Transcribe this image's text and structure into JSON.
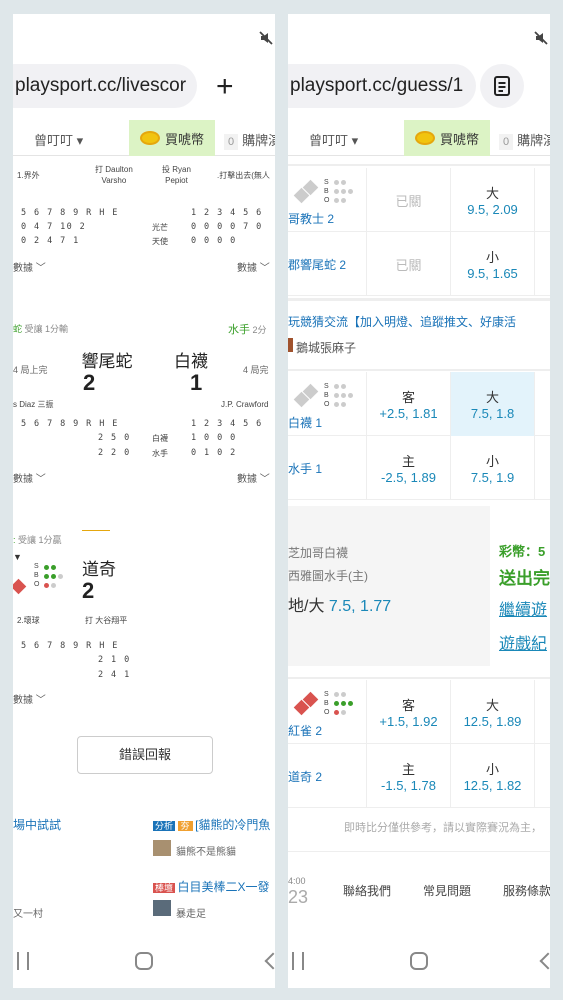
{
  "left": {
    "url": "playsport.cc/livescor",
    "plus": "+",
    "nav": {
      "dropdown": "曾叮叮 ▾",
      "coin": "買唬幣",
      "count": "0",
      "other": "購牌演"
    },
    "game1": {
      "row_label1": "1.界外",
      "batter": "打 Daulton\nVarsho",
      "pitcher": "投 Ryan\nPepiot",
      "right_label": ".打擊出去(無人",
      "innings_hdr": "5 6 7 8 9 R H E",
      "line_a": "0 4        7 10 2",
      "line_b": "0 2        4 7 1",
      "team_a": "光芒",
      "team_b": "天使",
      "inn_hdr_r": "1 2 3 4 5 6",
      "line_c": "0 0 0 0 7 0",
      "line_d": "0 0 0 0",
      "stat_l": "數據 ﹀",
      "stat_r": "數據 ﹀"
    },
    "game2": {
      "status_l": "受讓 1分輸",
      "status_r_team": "水手",
      "status_r": "2分",
      "inning_l": "4 局上完",
      "inning_r": "4 局完",
      "team_home": "響尾蛇",
      "score_home": "2",
      "team_away": "白襪",
      "score_away": "1",
      "pitcher_l": "s Diaz 三振",
      "pitcher_r": "J.P. Crawford",
      "innings_hdr": "5 6 7 8 9 R H E",
      "line_a": "2 5 0",
      "line_b": "2 2 0",
      "team_c": "白襪",
      "team_d": "水手",
      "inn_hdr_r": "1 2 3 4 5 6",
      "line_c": "1 0 0 0",
      "line_d": "0 1 0 2",
      "stat_l": "數據 ﹀",
      "stat_r": "數據 ﹀"
    },
    "game3": {
      "status": "受讓 1分贏",
      "team": "道奇",
      "score": "2",
      "batter_l": "2.壞球",
      "batter_r": "打 大谷翔平",
      "innings_hdr": "5 6 7 8 9 R H E",
      "line_a": "2 1 0",
      "line_b": "2 4 1",
      "stat": "數據 ﹀",
      "sbo": "S\nB\nO"
    },
    "error_btn": "錯誤回報",
    "news": {
      "item1_l": "場中試試",
      "tag1a": "分析",
      "tag1b": "夯",
      "item1_r": "[貓熊的冷門魚",
      "author1": "貓熊不是熊貓",
      "tag2": "棒壇",
      "item2_r": "白目美棒二X一發",
      "item2_l": "又一村",
      "author2": "暴走足"
    }
  },
  "right": {
    "url": "playsport.cc/guess/1",
    "nav": {
      "dropdown": "曾叮叮 ▾",
      "coin": "買唬幣",
      "count": "0",
      "other": "購牌演"
    },
    "closed": "已關",
    "match1": {
      "team_a": "哥教士 2",
      "team_b": "郡響尾蛇 2",
      "a_k": "大",
      "a_v": "9.5, 2.09",
      "b_k": "小",
      "b_v": "9.5, 1.65",
      "sbo": "S\nB\nO"
    },
    "forum": {
      "title": "玩競猜交流【加入明燈、追蹤推文、好康活",
      "author": "鵝城張麻子"
    },
    "match2": {
      "team_a": "白襪 1",
      "team_b": "水手 1",
      "a1_k": "客",
      "a1_v": "+2.5, 1.81",
      "a2_k": "大",
      "a2_v": "7.5, 1.8",
      "b1_k": "主",
      "b1_v": "-2.5, 1.89",
      "b2_k": "小",
      "b2_v": "7.5, 1.9",
      "sbo": "S\nB\nO"
    },
    "promo": {
      "line1": "芝加哥白襪",
      "line2": "西雅圖水手(主)",
      "line3_a": "地/大 ",
      "line3_b": "7.5, 1.77",
      "r1": "彩幣：5",
      "r2": "送出完",
      "r3": "繼續遊",
      "r4": "遊戲紀"
    },
    "match3": {
      "team_a": "紅雀 2",
      "team_b": "道奇 2",
      "a1_k": "客",
      "a1_v": "+1.5, 1.92",
      "a2_k": "大",
      "a2_v": "12.5, 1.89",
      "b1_k": "主",
      "b1_v": "-1.5, 1.78",
      "b2_k": "小",
      "b2_v": "12.5, 1.82",
      "sbo": "S\nB\nO"
    },
    "disclaimer": "即時比分僅供參考，請以實際賽況為主，",
    "footer": {
      "time_small": "4:00",
      "time_big": "23",
      "contact": "聯絡我們",
      "faq": "常見問題",
      "terms": "服務條款"
    }
  },
  "colors": {
    "accent_green": "#3a9f2a",
    "odds_blue": "#1a88b8",
    "coin_bg": "#dcf3c5",
    "highlight": "#e3f3fb"
  }
}
